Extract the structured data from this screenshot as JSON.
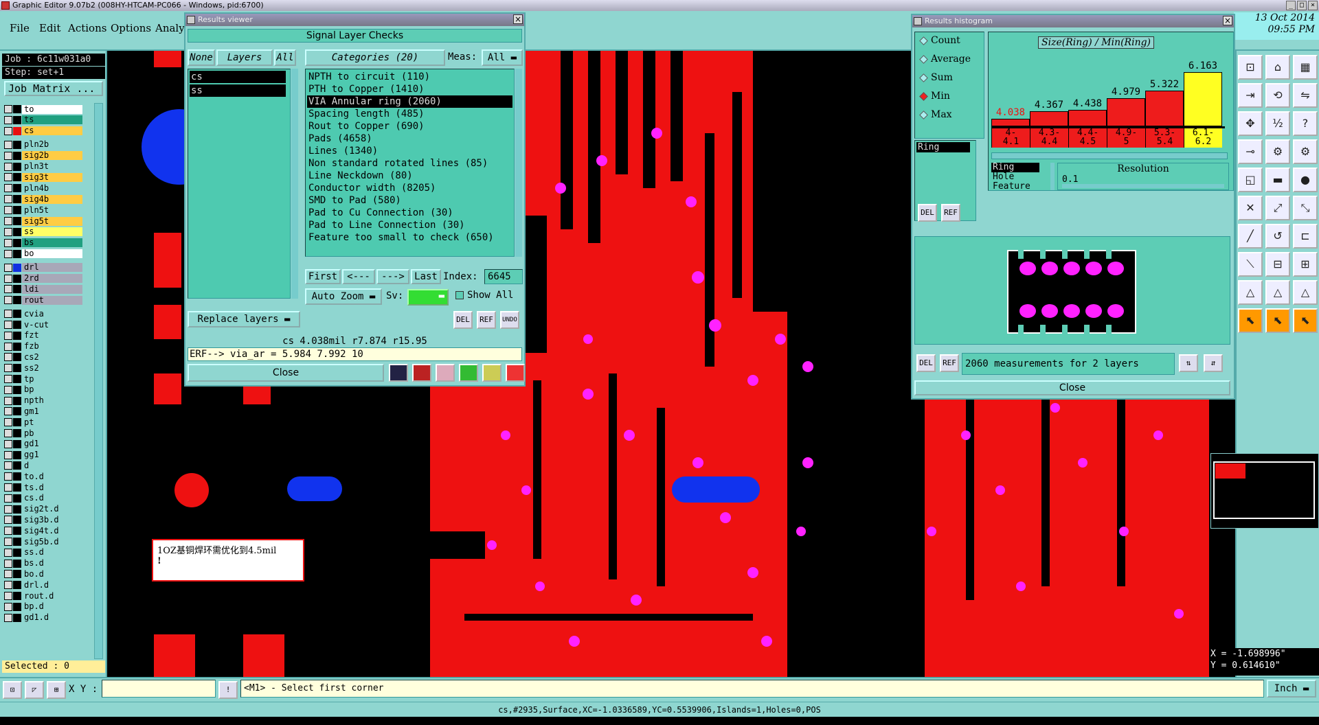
{
  "window": {
    "title": "Graphic Editor 9.07b2 (008HY-HTCAM-PC066 - Windows, pid:6700)",
    "date": "13 Oct 2014",
    "time": "09:55 PM"
  },
  "menu": [
    "File",
    "Edit",
    "Actions",
    "Options",
    "Analy:"
  ],
  "left": {
    "job": "Job : 6c11w031a0",
    "step": "Step: set+1",
    "job_matrix": "Job Matrix ...",
    "selected": "Selected : 0",
    "layers": [
      {
        "name": "to",
        "bg": "#ffffff",
        "swatch": ""
      },
      {
        "name": "ts",
        "bg": "#20a080",
        "swatch": ""
      },
      {
        "name": "cs",
        "bg": "#ffcc44",
        "swatch": "#e81010"
      },
      {
        "name": "pln2b",
        "bg": "#8fd6d0",
        "swatch": ""
      },
      {
        "name": "sig2b",
        "bg": "#ffcc44",
        "swatch": ""
      },
      {
        "name": "pln3t",
        "bg": "#8fd6d0",
        "swatch": ""
      },
      {
        "name": "sig3t",
        "bg": "#ffcc44",
        "swatch": ""
      },
      {
        "name": "pln4b",
        "bg": "#8fd6d0",
        "swatch": ""
      },
      {
        "name": "sig4b",
        "bg": "#ffcc44",
        "swatch": ""
      },
      {
        "name": "pln5t",
        "bg": "#8fd6d0",
        "swatch": ""
      },
      {
        "name": "sig5t",
        "bg": "#ffcc44",
        "swatch": ""
      },
      {
        "name": "ss",
        "bg": "#ffff66",
        "swatch": ""
      },
      {
        "name": "bs",
        "bg": "#20a080",
        "swatch": ""
      },
      {
        "name": "bo",
        "bg": "#ffffff",
        "swatch": ""
      },
      {
        "name": "drl",
        "bg": "#a8a8b8",
        "swatch": "#1030e0"
      },
      {
        "name": "2rd",
        "bg": "#a8a8b8",
        "swatch": ""
      },
      {
        "name": "ldi",
        "bg": "#a8a8b8",
        "swatch": ""
      },
      {
        "name": "rout",
        "bg": "#a8a8b8",
        "swatch": ""
      },
      {
        "name": "cvia",
        "bg": "#8fd6d0",
        "swatch": ""
      },
      {
        "name": "v-cut",
        "bg": "#8fd6d0",
        "swatch": ""
      },
      {
        "name": "fzt",
        "bg": "#8fd6d0",
        "swatch": ""
      },
      {
        "name": "fzb",
        "bg": "#8fd6d0",
        "swatch": ""
      },
      {
        "name": "cs2",
        "bg": "#8fd6d0",
        "swatch": ""
      },
      {
        "name": "ss2",
        "bg": "#8fd6d0",
        "swatch": ""
      },
      {
        "name": "tp",
        "bg": "#8fd6d0",
        "swatch": ""
      },
      {
        "name": "bp",
        "bg": "#8fd6d0",
        "swatch": ""
      },
      {
        "name": "npth",
        "bg": "#8fd6d0",
        "swatch": ""
      },
      {
        "name": "gm1",
        "bg": "#8fd6d0",
        "swatch": ""
      },
      {
        "name": "pt",
        "bg": "#8fd6d0",
        "swatch": ""
      },
      {
        "name": "pb",
        "bg": "#8fd6d0",
        "swatch": ""
      },
      {
        "name": "gd1",
        "bg": "#8fd6d0",
        "swatch": ""
      },
      {
        "name": "gg1",
        "bg": "#8fd6d0",
        "swatch": ""
      },
      {
        "name": "d",
        "bg": "#8fd6d0",
        "swatch": ""
      },
      {
        "name": "to.d",
        "bg": "#8fd6d0",
        "swatch": ""
      },
      {
        "name": "ts.d",
        "bg": "#8fd6d0",
        "swatch": ""
      },
      {
        "name": "cs.d",
        "bg": "#8fd6d0",
        "swatch": ""
      },
      {
        "name": "sig2t.d",
        "bg": "#8fd6d0",
        "swatch": ""
      },
      {
        "name": "sig3b.d",
        "bg": "#8fd6d0",
        "swatch": ""
      },
      {
        "name": "sig4t.d",
        "bg": "#8fd6d0",
        "swatch": ""
      },
      {
        "name": "sig5b.d",
        "bg": "#8fd6d0",
        "swatch": ""
      },
      {
        "name": "ss.d",
        "bg": "#8fd6d0",
        "swatch": ""
      },
      {
        "name": "bs.d",
        "bg": "#8fd6d0",
        "swatch": ""
      },
      {
        "name": "bo.d",
        "bg": "#8fd6d0",
        "swatch": ""
      },
      {
        "name": "drl.d",
        "bg": "#8fd6d0",
        "swatch": ""
      },
      {
        "name": "rout.d",
        "bg": "#8fd6d0",
        "swatch": ""
      },
      {
        "name": "bp.d",
        "bg": "#8fd6d0",
        "swatch": ""
      },
      {
        "name": "gd1.d",
        "bg": "#8fd6d0",
        "swatch": ""
      }
    ]
  },
  "note": {
    "line1": "1OZ基铜焊环需优化到4.5mil",
    "line2": "!"
  },
  "results_viewer": {
    "title": "Results viewer",
    "header": "Signal Layer Checks",
    "none": "None",
    "layers": "Layers",
    "all": "All",
    "categories_btn": "Categories (20)",
    "meas_label": "Meas:",
    "meas_value": "All",
    "layer_list": [
      "cs",
      "ss"
    ],
    "categories": [
      "NPTH to circuit (110)",
      "PTH to Copper (1410)",
      "VIA Annular ring (2060)",
      "Spacing length (485)",
      "Rout to Copper (690)",
      "Pads (4658)",
      "Lines (1340)",
      "Non standard rotated lines (85)",
      "Line Neckdown (80)",
      "Conductor width (8205)",
      "SMD to Pad (580)",
      "Pad to Cu Connection (30)",
      "Pad to Line Connection (30)",
      "Feature too small to check (650)"
    ],
    "selected_category": 2,
    "first": "First",
    "prev": "<---",
    "next": "--->",
    "last": "Last",
    "index_label": "Index:",
    "index_value": "6645",
    "auto_zoom": "Auto Zoom",
    "sv": "Sv:",
    "show_all": "Show All",
    "replace_layers": "Replace layers",
    "measure_line": "cs 4.038mil  r7.874  r15.95",
    "erf_line": "ERF--> via_ar = 5.984 7.992 10",
    "close": "Close",
    "del": "DEL",
    "ref": "REF",
    "undo": "UNDO"
  },
  "histogram": {
    "title": "Results histogram",
    "chart_title": "Size(Ring) / Min(Ring)",
    "modes": [
      "Count",
      "Average",
      "Sum",
      "Min",
      "Max"
    ],
    "selected_mode": "Min",
    "left_list": [
      "Ring"
    ],
    "resolution_label": "Resolution",
    "resolution_value": "0.1",
    "res_list": [
      "Ring",
      "Hole",
      "Feature"
    ],
    "summary": "2060 measurements for 2 layers",
    "close": "Close",
    "del": "DEL",
    "ref": "REF"
  },
  "chart_data": {
    "type": "bar",
    "title": "Size(Ring) / Min(Ring)",
    "categories": [
      "4-4.1",
      "4.3-4.4",
      "4.4-4.5",
      "4.9-5",
      "5.3-5.4",
      "6.1-6.2"
    ],
    "bin_labels": [
      [
        "4-",
        "4.1"
      ],
      [
        "4.3-",
        "4.4"
      ],
      [
        "4.4-",
        "4.5"
      ],
      [
        "4.9-",
        "5"
      ],
      [
        "5.3-",
        "5.4"
      ],
      [
        "6.1-",
        "6.2"
      ]
    ],
    "values": [
      4.038,
      4.367,
      4.438,
      4.979,
      5.322,
      6.163
    ],
    "value_labels": [
      "4.038",
      "4.367",
      "4.438",
      "4.979",
      "5.322",
      "6.163"
    ],
    "colors": [
      "#ee1c1c",
      "#ee1c1c",
      "#ee1c1c",
      "#ee1c1c",
      "#ee1c1c",
      "#ffff22"
    ]
  },
  "coords": {
    "x": "X = -1.698996\"",
    "y": "Y = 0.614610\""
  },
  "bottom": {
    "xy_label": "X Y :",
    "xy_value": "",
    "hint": "<M1> - Select first corner",
    "unit": "Inch"
  },
  "status": "cs,#2935,Surface,XC=-1.0336589,YC=0.5539906,Islands=1,Holes=0,POS"
}
